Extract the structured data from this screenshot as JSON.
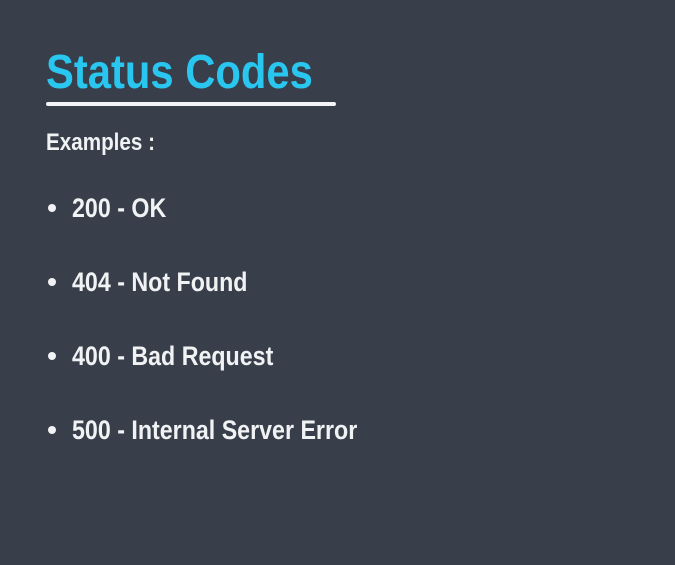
{
  "slide": {
    "title": "Status Codes",
    "subtitle": "Examples :",
    "items": [
      "200 - OK",
      "404 - Not Found",
      "400 - Bad Request",
      "500 - Internal Server Error"
    ]
  },
  "colors": {
    "background": "#383e4a",
    "title": "#29c7f0",
    "text": "#f1f2f4"
  }
}
